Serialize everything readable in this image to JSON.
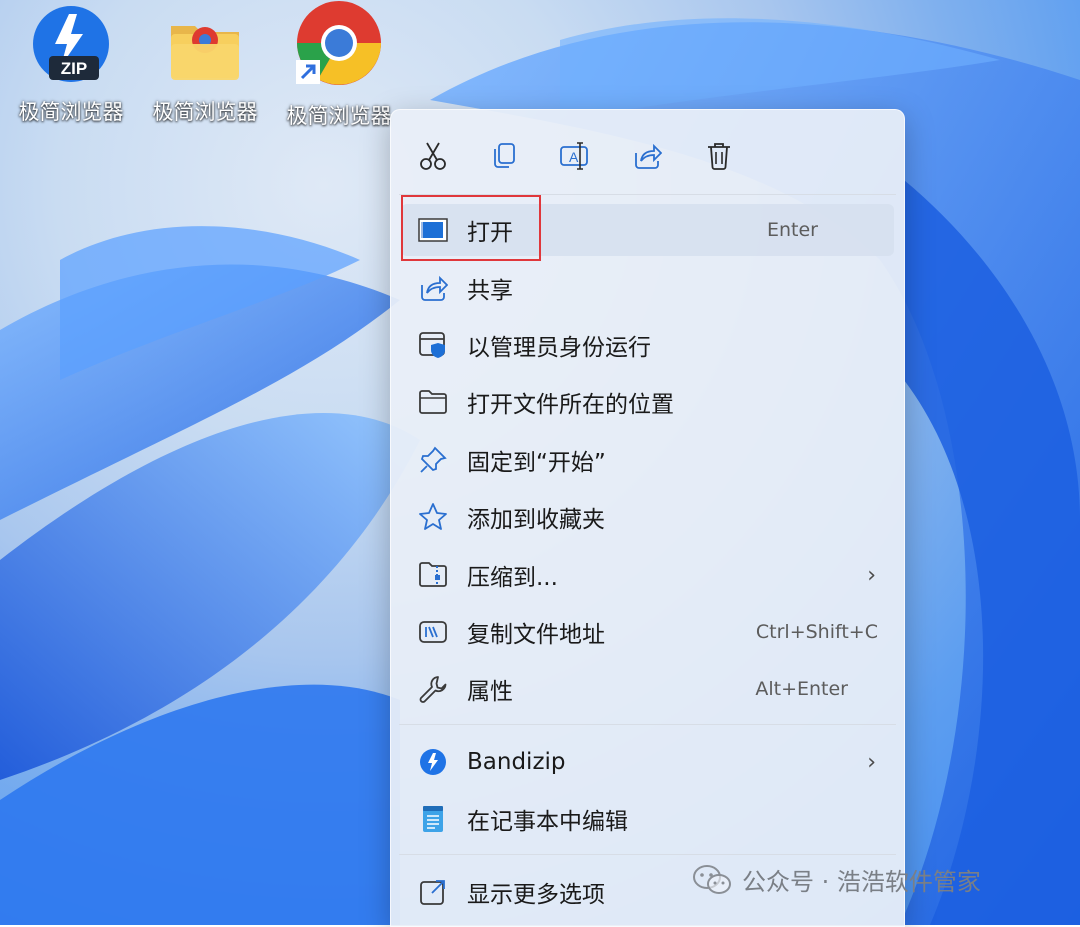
{
  "desktop": {
    "icons": [
      {
        "label": "极简浏览器",
        "icon": "bandizip-zip-icon"
      },
      {
        "label": "极简浏览器",
        "icon": "folder-icon"
      },
      {
        "label": "极简浏览器",
        "icon": "chrome-shortcut-icon"
      }
    ],
    "zip_badge": "ZIP"
  },
  "context_menu": {
    "quick_actions": [
      {
        "name": "cut",
        "icon": "scissors-icon"
      },
      {
        "name": "copy",
        "icon": "copy-icon"
      },
      {
        "name": "rename",
        "icon": "rename-icon"
      },
      {
        "name": "share",
        "icon": "share-icon"
      },
      {
        "name": "delete",
        "icon": "trash-icon"
      }
    ],
    "items": [
      {
        "label": "打开",
        "shortcut": "Enter",
        "icon": "app-window-icon"
      },
      {
        "label": "共享",
        "icon": "share-icon"
      },
      {
        "label": "以管理员身份运行",
        "icon": "shield-window-icon"
      },
      {
        "label": "打开文件所在的位置",
        "icon": "folder-outline-icon"
      },
      {
        "label": "固定到“开始”",
        "icon": "pin-icon"
      },
      {
        "label": "添加到收藏夹",
        "icon": "star-icon"
      },
      {
        "label": "压缩到...",
        "icon": "zip-folder-icon",
        "submenu": true
      },
      {
        "label": "复制文件地址",
        "shortcut": "Ctrl+Shift+C",
        "icon": "path-icon"
      },
      {
        "label": "属性",
        "shortcut": "Alt+Enter",
        "icon": "wrench-icon"
      },
      {
        "label": "Bandizip",
        "icon": "bandizip-icon",
        "submenu": true
      },
      {
        "label": "在记事本中编辑",
        "icon": "notepad-icon"
      },
      {
        "label": "显示更多选项",
        "icon": "more-options-icon"
      }
    ],
    "submenu_glyph": "›"
  },
  "watermark": {
    "text": "公众号 · 浩浩软件管家"
  },
  "colors": {
    "highlight_box": "#e0373b",
    "accent": "#2f6fde"
  }
}
